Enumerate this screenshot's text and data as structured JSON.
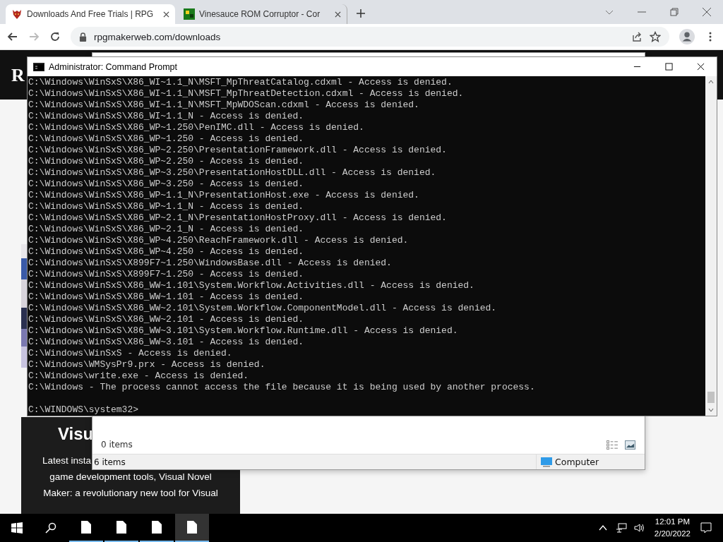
{
  "browser": {
    "tabs": [
      {
        "title": "Downloads And Free Trials | RPG",
        "selected": true
      },
      {
        "title": "Vinesauce ROM Corruptor - Cor",
        "selected": false
      }
    ],
    "address": "rpgmakerweb.com/downloads",
    "page": {
      "logo": "R",
      "heading": "Visu",
      "lines": [
        "Latest insta",
        "game development tools, Visual Novel",
        "Maker: a revolutionary new tool for Visual"
      ]
    }
  },
  "explorer": {
    "items": "0 items",
    "status_count": "6 items",
    "location": "Computer"
  },
  "console": {
    "title": "Administrator: Command Prompt",
    "lines": [
      "C:\\Windows\\WinSxS\\X86_WI~1.1_N\\MSFT_MpThreatCatalog.cdxml - Access is denied.",
      "C:\\Windows\\WinSxS\\X86_WI~1.1_N\\MSFT_MpThreatDetection.cdxml - Access is denied.",
      "C:\\Windows\\WinSxS\\X86_WI~1.1_N\\MSFT_MpWDOScan.cdxml - Access is denied.",
      "C:\\Windows\\WinSxS\\X86_WI~1.1_N - Access is denied.",
      "C:\\Windows\\WinSxS\\X86_WP~1.250\\PenIMC.dll - Access is denied.",
      "C:\\Windows\\WinSxS\\X86_WP~1.250 - Access is denied.",
      "C:\\Windows\\WinSxS\\X86_WP~2.250\\PresentationFramework.dll - Access is denied.",
      "C:\\Windows\\WinSxS\\X86_WP~2.250 - Access is denied.",
      "C:\\Windows\\WinSxS\\X86_WP~3.250\\PresentationHostDLL.dll - Access is denied.",
      "C:\\Windows\\WinSxS\\X86_WP~3.250 - Access is denied.",
      "C:\\Windows\\WinSxS\\X86_WP~1.1_N\\PresentationHost.exe - Access is denied.",
      "C:\\Windows\\WinSxS\\X86_WP~1.1_N - Access is denied.",
      "C:\\Windows\\WinSxS\\X86_WP~2.1_N\\PresentationHostProxy.dll - Access is denied.",
      "C:\\Windows\\WinSxS\\X86_WP~2.1_N - Access is denied.",
      "C:\\Windows\\WinSxS\\X86_WP~4.250\\ReachFramework.dll - Access is denied.",
      "C:\\Windows\\WinSxS\\X86_WP~4.250 - Access is denied.",
      "C:\\Windows\\WinSxS\\X899F7~1.250\\WindowsBase.dll - Access is denied.",
      "C:\\Windows\\WinSxS\\X899F7~1.250 - Access is denied.",
      "C:\\Windows\\WinSxS\\X86_WW~1.101\\System.Workflow.Activities.dll - Access is denied.",
      "C:\\Windows\\WinSxS\\X86_WW~1.101 - Access is denied.",
      "C:\\Windows\\WinSxS\\X86_WW~2.101\\System.Workflow.ComponentModel.dll - Access is denied.",
      "C:\\Windows\\WinSxS\\X86_WW~2.101 - Access is denied.",
      "C:\\Windows\\WinSxS\\X86_WW~3.101\\System.Workflow.Runtime.dll - Access is denied.",
      "C:\\Windows\\WinSxS\\X86_WW~3.101 - Access is denied.",
      "C:\\Windows\\WinSxS - Access is denied.",
      "C:\\Windows\\WMSysPr9.prx - Access is denied.",
      "C:\\Windows\\write.exe - Access is denied.",
      "C:\\Windows - The process cannot access the file because it is being used by another process."
    ],
    "prompt": "C:\\WINDOWS\\system32>"
  },
  "taskbar": {
    "apps": [
      {
        "selected": false
      },
      {
        "selected": false
      },
      {
        "selected": false
      },
      {
        "selected": true
      }
    ],
    "time": "12:01 PM",
    "date": "2/20/2022"
  }
}
